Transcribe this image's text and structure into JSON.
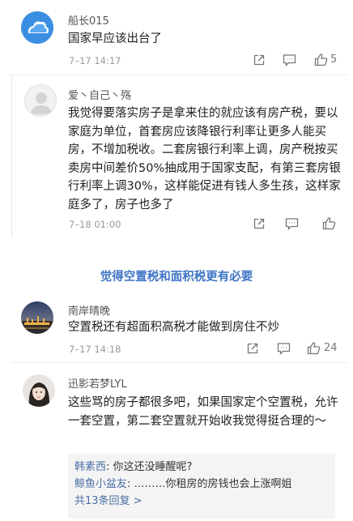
{
  "comments": [
    {
      "username": "船长015",
      "text": "国家早应该出台了",
      "date": "7–17 14:17",
      "likes": "5"
    },
    {
      "username": "爱丶自己丶殇",
      "text": "我觉得要落实房子是拿来住的就应该有房产税，要以家庭为单位，首套房应该降银行利率让更多人能买房，不增加税收。二套房银行利率上调，房产税按买卖房中间差价50%抽成用于国家支配，有第三套房银行利率上调30%，这样能促进有钱人多生孩，这样家庭多了，房子也多了",
      "date": "7–18 01:00",
      "likes": ""
    },
    {
      "username": "南岸晴晚",
      "text": "空置税还有超面积高税才能做到房住不炒",
      "date": "7–17 14:18",
      "likes": "24"
    },
    {
      "username": "迅影若梦LYL",
      "text": "这些骂的房子都很多吧，如果国家定个空置税，允许一套空置，第二套空置就开始收我觉得挺合理的～"
    }
  ],
  "section": {
    "title": "觉得空置税和面积税更有必要"
  },
  "replies": [
    {
      "name": "韩素西",
      "text": "你这还没睡醒呢?"
    },
    {
      "name": "鲸鱼小盆友",
      "text": "………你租房的房钱也会上涨啊姐"
    }
  ],
  "more_replies": "共13条回复 >",
  "icons": {
    "share": "share-icon",
    "comment": "comment-icon",
    "like": "thumbs-up-icon"
  },
  "colors": {
    "link": "#3d73c4",
    "meta": "#9a9a9a"
  }
}
